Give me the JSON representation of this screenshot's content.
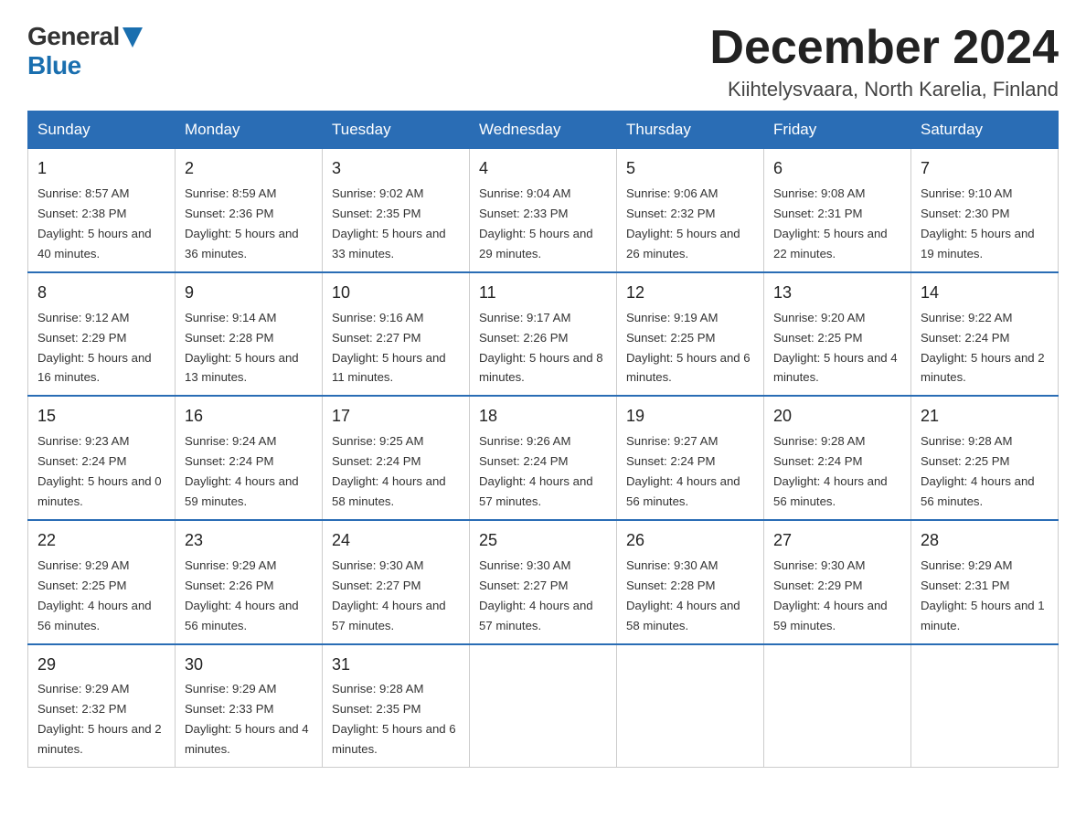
{
  "logo": {
    "general": "General",
    "blue": "Blue"
  },
  "header": {
    "month": "December 2024",
    "location": "Kiihtelysvaara, North Karelia, Finland"
  },
  "days_of_week": [
    "Sunday",
    "Monday",
    "Tuesday",
    "Wednesday",
    "Thursday",
    "Friday",
    "Saturday"
  ],
  "weeks": [
    [
      {
        "day": "1",
        "sunrise": "8:57 AM",
        "sunset": "2:38 PM",
        "daylight": "5 hours and 40 minutes."
      },
      {
        "day": "2",
        "sunrise": "8:59 AM",
        "sunset": "2:36 PM",
        "daylight": "5 hours and 36 minutes."
      },
      {
        "day": "3",
        "sunrise": "9:02 AM",
        "sunset": "2:35 PM",
        "daylight": "5 hours and 33 minutes."
      },
      {
        "day": "4",
        "sunrise": "9:04 AM",
        "sunset": "2:33 PM",
        "daylight": "5 hours and 29 minutes."
      },
      {
        "day": "5",
        "sunrise": "9:06 AM",
        "sunset": "2:32 PM",
        "daylight": "5 hours and 26 minutes."
      },
      {
        "day": "6",
        "sunrise": "9:08 AM",
        "sunset": "2:31 PM",
        "daylight": "5 hours and 22 minutes."
      },
      {
        "day": "7",
        "sunrise": "9:10 AM",
        "sunset": "2:30 PM",
        "daylight": "5 hours and 19 minutes."
      }
    ],
    [
      {
        "day": "8",
        "sunrise": "9:12 AM",
        "sunset": "2:29 PM",
        "daylight": "5 hours and 16 minutes."
      },
      {
        "day": "9",
        "sunrise": "9:14 AM",
        "sunset": "2:28 PM",
        "daylight": "5 hours and 13 minutes."
      },
      {
        "day": "10",
        "sunrise": "9:16 AM",
        "sunset": "2:27 PM",
        "daylight": "5 hours and 11 minutes."
      },
      {
        "day": "11",
        "sunrise": "9:17 AM",
        "sunset": "2:26 PM",
        "daylight": "5 hours and 8 minutes."
      },
      {
        "day": "12",
        "sunrise": "9:19 AM",
        "sunset": "2:25 PM",
        "daylight": "5 hours and 6 minutes."
      },
      {
        "day": "13",
        "sunrise": "9:20 AM",
        "sunset": "2:25 PM",
        "daylight": "5 hours and 4 minutes."
      },
      {
        "day": "14",
        "sunrise": "9:22 AM",
        "sunset": "2:24 PM",
        "daylight": "5 hours and 2 minutes."
      }
    ],
    [
      {
        "day": "15",
        "sunrise": "9:23 AM",
        "sunset": "2:24 PM",
        "daylight": "5 hours and 0 minutes."
      },
      {
        "day": "16",
        "sunrise": "9:24 AM",
        "sunset": "2:24 PM",
        "daylight": "4 hours and 59 minutes."
      },
      {
        "day": "17",
        "sunrise": "9:25 AM",
        "sunset": "2:24 PM",
        "daylight": "4 hours and 58 minutes."
      },
      {
        "day": "18",
        "sunrise": "9:26 AM",
        "sunset": "2:24 PM",
        "daylight": "4 hours and 57 minutes."
      },
      {
        "day": "19",
        "sunrise": "9:27 AM",
        "sunset": "2:24 PM",
        "daylight": "4 hours and 56 minutes."
      },
      {
        "day": "20",
        "sunrise": "9:28 AM",
        "sunset": "2:24 PM",
        "daylight": "4 hours and 56 minutes."
      },
      {
        "day": "21",
        "sunrise": "9:28 AM",
        "sunset": "2:25 PM",
        "daylight": "4 hours and 56 minutes."
      }
    ],
    [
      {
        "day": "22",
        "sunrise": "9:29 AM",
        "sunset": "2:25 PM",
        "daylight": "4 hours and 56 minutes."
      },
      {
        "day": "23",
        "sunrise": "9:29 AM",
        "sunset": "2:26 PM",
        "daylight": "4 hours and 56 minutes."
      },
      {
        "day": "24",
        "sunrise": "9:30 AM",
        "sunset": "2:27 PM",
        "daylight": "4 hours and 57 minutes."
      },
      {
        "day": "25",
        "sunrise": "9:30 AM",
        "sunset": "2:27 PM",
        "daylight": "4 hours and 57 minutes."
      },
      {
        "day": "26",
        "sunrise": "9:30 AM",
        "sunset": "2:28 PM",
        "daylight": "4 hours and 58 minutes."
      },
      {
        "day": "27",
        "sunrise": "9:30 AM",
        "sunset": "2:29 PM",
        "daylight": "4 hours and 59 minutes."
      },
      {
        "day": "28",
        "sunrise": "9:29 AM",
        "sunset": "2:31 PM",
        "daylight": "5 hours and 1 minute."
      }
    ],
    [
      {
        "day": "29",
        "sunrise": "9:29 AM",
        "sunset": "2:32 PM",
        "daylight": "5 hours and 2 minutes."
      },
      {
        "day": "30",
        "sunrise": "9:29 AM",
        "sunset": "2:33 PM",
        "daylight": "5 hours and 4 minutes."
      },
      {
        "day": "31",
        "sunrise": "9:28 AM",
        "sunset": "2:35 PM",
        "daylight": "5 hours and 6 minutes."
      },
      null,
      null,
      null,
      null
    ]
  ]
}
